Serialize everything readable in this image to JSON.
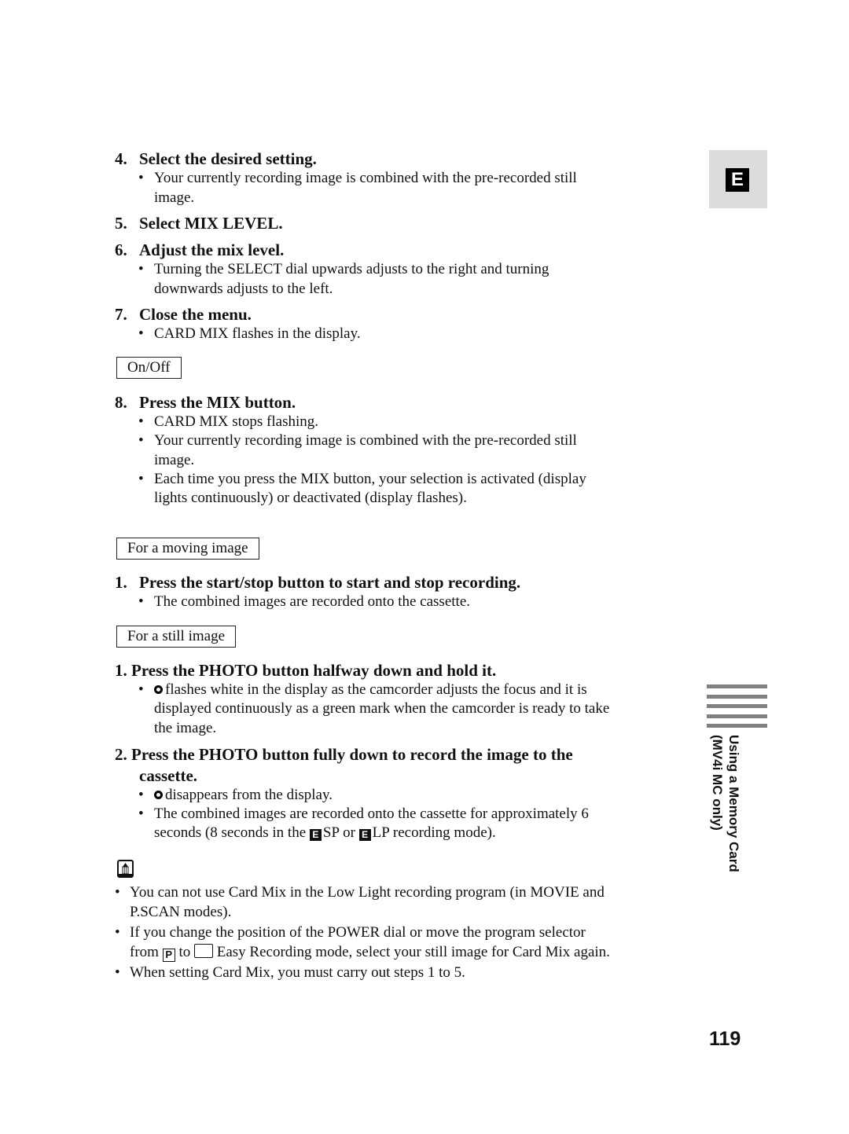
{
  "side_tab": {
    "letter": "E"
  },
  "steps_top": [
    {
      "num": "4.",
      "title": "Select the desired setting.",
      "bullets": [
        [
          "Your currently recording image is combined with the pre-recorded still",
          "image."
        ]
      ]
    },
    {
      "num": "5.",
      "title": "Select MIX LEVEL.",
      "bullets": []
    },
    {
      "num": "6.",
      "title": "Adjust the mix level.",
      "bullets": [
        [
          "Turning the SELECT dial upwards adjusts to the right and turning",
          "downwards adjusts to the left."
        ]
      ]
    },
    {
      "num": "7.",
      "title": "Close the menu.",
      "bullets": [
        [
          "CARD MIX flashes in the display."
        ]
      ]
    }
  ],
  "label_onoff": "On/Off",
  "step8": {
    "num": "8.",
    "title": "Press the MIX button.",
    "bullets": [
      [
        "CARD MIX stops flashing."
      ],
      [
        "Your currently recording image is combined with the pre-recorded still",
        "image."
      ],
      [
        "Each time you press the MIX button, your selection is activated (display",
        "lights continuously) or deactivated (display flashes)."
      ]
    ]
  },
  "moving": {
    "label": "For a moving image",
    "step": {
      "num": "1.",
      "title": "Press the start/stop button to start and stop recording.",
      "bullets": [
        [
          "The combined images are recorded onto the cassette."
        ]
      ]
    }
  },
  "still": {
    "label": "For a still image",
    "step1": {
      "title": "1. Press the PHOTO button halfway down and hold it.",
      "b1_l1": "flashes white in the display as the camcorder adjusts the focus and it is",
      "b1_l2": "displayed continuously as a green mark when the camcorder is ready to take",
      "b1_l3": "the image."
    },
    "step2": {
      "title_l1": "2. Press the PHOTO button fully down to record the image to the",
      "title_l2": "cassette.",
      "b1": "disappears from the display.",
      "b2_l1": "The combined images are recorded onto the cassette for approximately 6",
      "b2_l2a": "seconds (8 seconds in the ",
      "b2_l2b": "SP or ",
      "b2_l2c": "LP recording mode).",
      "mode_icon_letter": "E"
    }
  },
  "notes": {
    "icon": "note-pencil-icon",
    "n1_l1": "You can not use Card Mix in the Low Light recording program (in MOVIE and",
    "n1_l2": "P.SCAN modes).",
    "n2_l1": "If you change the position of the POWER dial or move the program selector",
    "n2_l2a": "from ",
    "n2_p": "P",
    "n2_l2b": " to ",
    "n2_l2c": " Easy Recording mode, select your still image for Card Mix again.",
    "n3": "When setting Card Mix, you must carry out steps 1 to 5."
  },
  "section_tab": {
    "line1": "Using a Memory Card",
    "line2": "(MV4i MC only)"
  },
  "page_number": "119",
  "bullet_char": "•"
}
